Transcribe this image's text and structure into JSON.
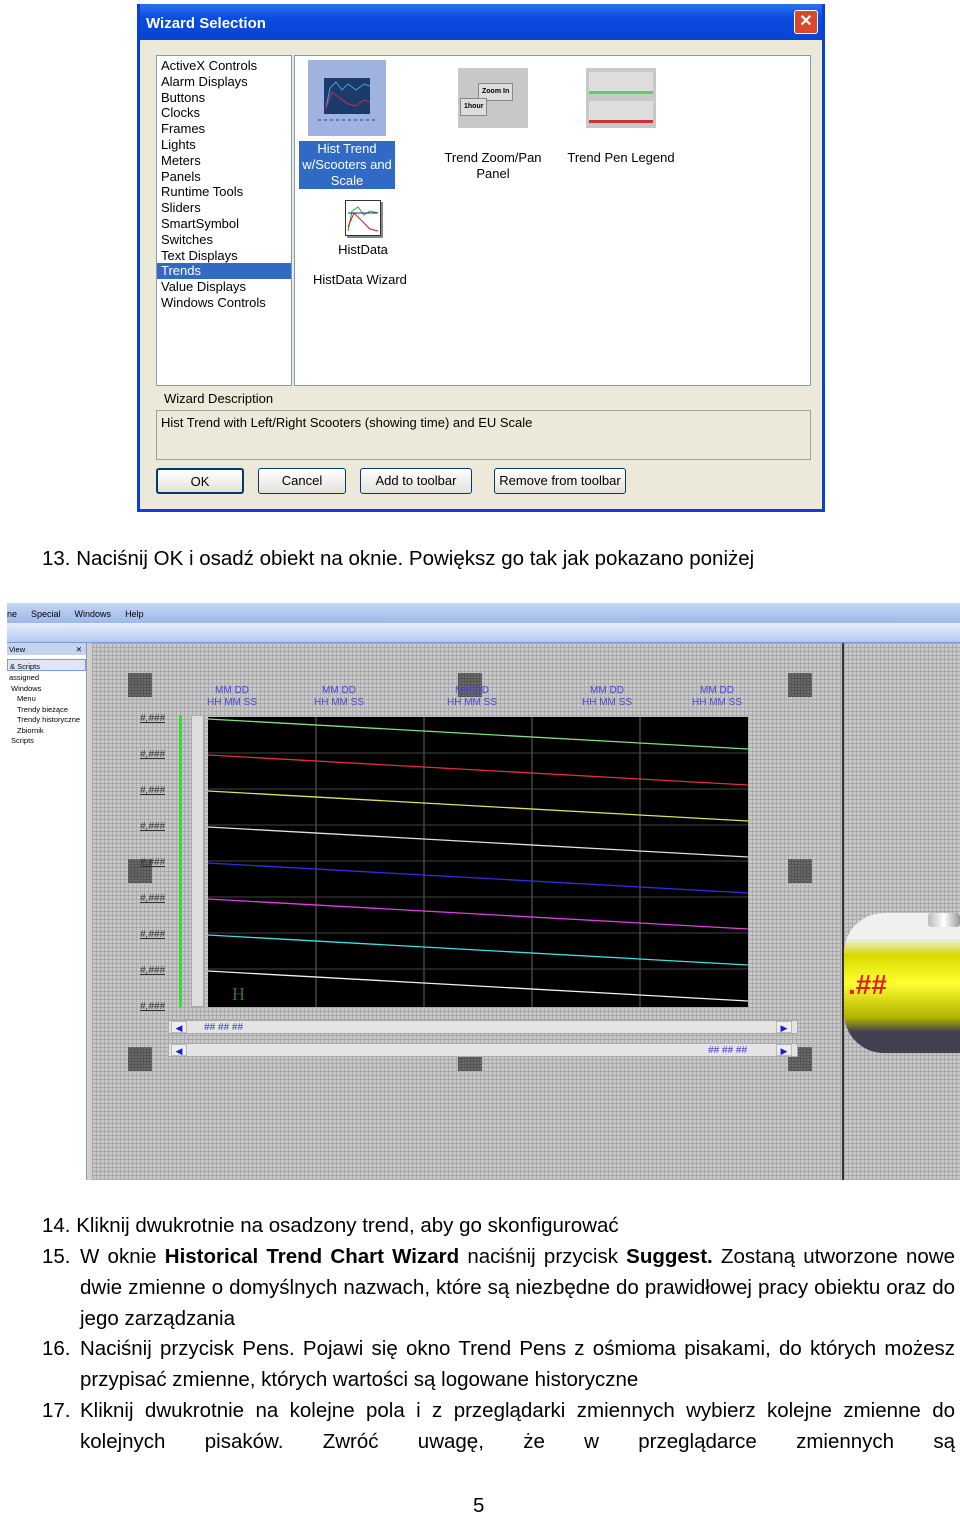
{
  "wizard": {
    "title": "Wizard Selection",
    "close": "✕",
    "categories": [
      "ActiveX Controls",
      "Alarm Displays",
      "Buttons",
      "Clocks",
      "Frames",
      "Lights",
      "Meters",
      "Panels",
      "Runtime Tools",
      "Sliders",
      "SmartSymbol",
      "Switches",
      "Text Displays",
      "Trends",
      "Value Displays",
      "Windows Controls"
    ],
    "selected_category": "Trends",
    "items": [
      {
        "label": "Hist Trend w/Scooters and Scale",
        "selected": true
      },
      {
        "label": "Trend Zoom/Pan Panel"
      },
      {
        "label": "Trend Pen Legend"
      },
      {
        "label": "HistData"
      }
    ],
    "icon_texts": {
      "zoom_in": "Zoom In",
      "hour": "1hour"
    },
    "group_label": "HistData Wizard",
    "description_label": "Wizard Description",
    "description": "Hist Trend with Left/Right Scooters (showing time) and EU Scale",
    "buttons": {
      "ok": "OK",
      "cancel": "Cancel",
      "add": "Add to toolbar",
      "remove": "Remove from toolbar"
    }
  },
  "step13": "13. Naciśnij OK i osadź obiekt na oknie. Powiększ go tak jak pokazano poniżej",
  "editor": {
    "menu": [
      "ne",
      "Special",
      "Windows",
      "Help"
    ],
    "panel_title": "View",
    "panel_close": "✕",
    "panel_dropdown": "& Scripts",
    "tree": [
      "assigned",
      "Windows",
      "Menu",
      "Trendy bieżące",
      "Trendy historyczne",
      "Zbiornik",
      "Scripts"
    ],
    "time_label_1": "MM DD",
    "time_label_2": "HH MM SS",
    "value_label": "#,###",
    "pen_marker": "H",
    "scooter_time": "## ## ##",
    "tank_value": ".##",
    "pen_colors": [
      "#7fe07f",
      "#e03040",
      "#e0e060",
      "#e0e0e0",
      "#3030e0",
      "#e040e0",
      "#40e0e0",
      "#f0f0f0"
    ]
  },
  "step14": "14. Kliknij dwukrotnie na osadzony trend, aby go skonfigurować",
  "step15": {
    "num": "15.",
    "t1": "W oknie ",
    "b1": "Historical Trend Chart Wizard",
    "t2": " naciśnij przycisk ",
    "b2": "Suggest.",
    "t3": " Zostaną utworzone nowe dwie zmienne o domyślnych nazwach, które są niezbędne do prawidłowej pracy obiektu oraz do jego zarządzania"
  },
  "step16": {
    "num": "16.",
    "text": "Naciśnij przycisk Pens. Pojawi się okno Trend Pens z ośmioma pisakami, do których możesz przypisać zmienne, których wartości są logowane historyczne"
  },
  "step17": {
    "num": "17.",
    "text": "Kliknij dwukrotnie na kolejne pola i z przeglądarki zmiennych wybierz kolejne zmienne do kolejnych pisaków. Zwróć uwagę, że w przeglądarce zmiennych są"
  },
  "page_number": "5"
}
